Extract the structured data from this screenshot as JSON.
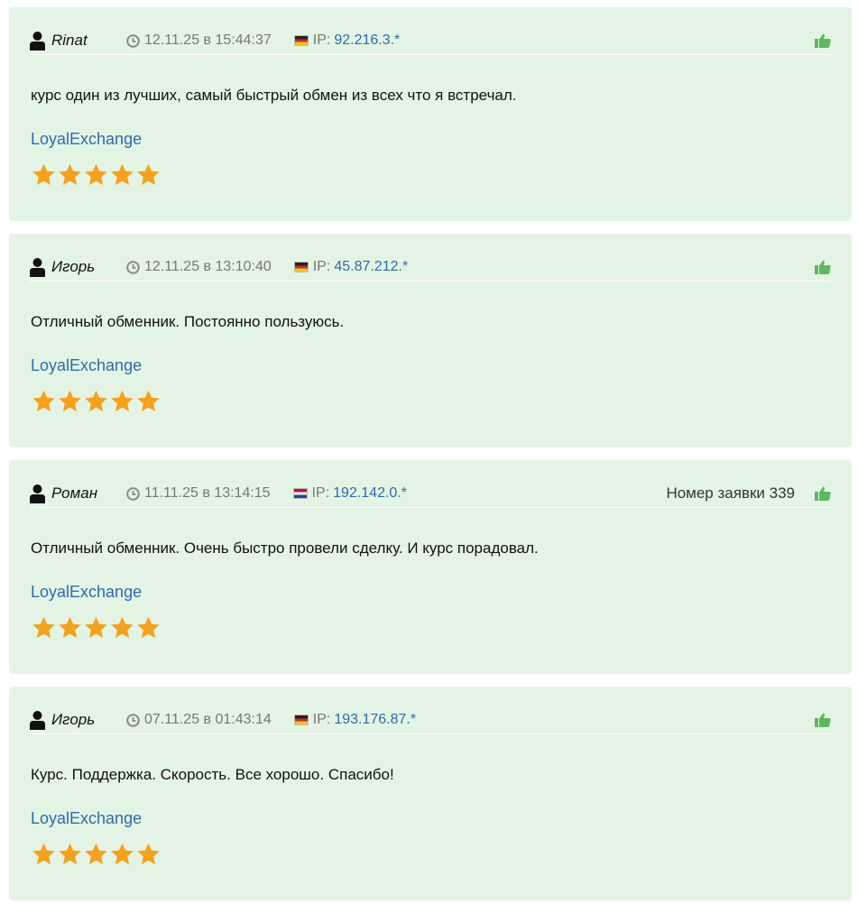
{
  "reviews": [
    {
      "author": "Rinat",
      "date": "12.11.25 в 15:44:37",
      "ip_label": "IP:",
      "ip": "92.216.3.*",
      "flag": "de",
      "order": "",
      "text": "курс один из лучших, самый быстрый обмен из всех что я встречал.",
      "service": "LoyalExchange",
      "rating": 5
    },
    {
      "author": "Игорь",
      "date": "12.11.25 в 13:10:40",
      "ip_label": "IP:",
      "ip": "45.87.212.*",
      "flag": "de",
      "order": "",
      "text": "Отличный обменник. Постоянно пользуюсь.",
      "service": "LoyalExchange",
      "rating": 5
    },
    {
      "author": "Роман",
      "date": "11.11.25 в 13:14:15",
      "ip_label": "IP:",
      "ip": "192.142.0.*",
      "flag": "nl",
      "order": "Номер заявки 339",
      "text": "Отличный обменник. Очень быстро провели сделку. И курс порадовал.",
      "service": "LoyalExchange",
      "rating": 5
    },
    {
      "author": "Игорь",
      "date": "07.11.25 в 01:43:14",
      "ip_label": "IP:",
      "ip": "193.176.87.*",
      "flag": "de",
      "order": "",
      "text": "Курс. Поддержка. Скорость. Все хорошо. Спасибо!",
      "service": "LoyalExchange",
      "rating": 5
    }
  ],
  "icons": {
    "user": "user-icon",
    "clock": "clock-icon",
    "like": "thumbs-up-icon",
    "star": "star-icon"
  },
  "colors": {
    "card_background": "#e4f4e4",
    "link": "#2b6bb3",
    "star": "#f5a11c",
    "like": "#5cb85c",
    "muted": "#777777"
  }
}
